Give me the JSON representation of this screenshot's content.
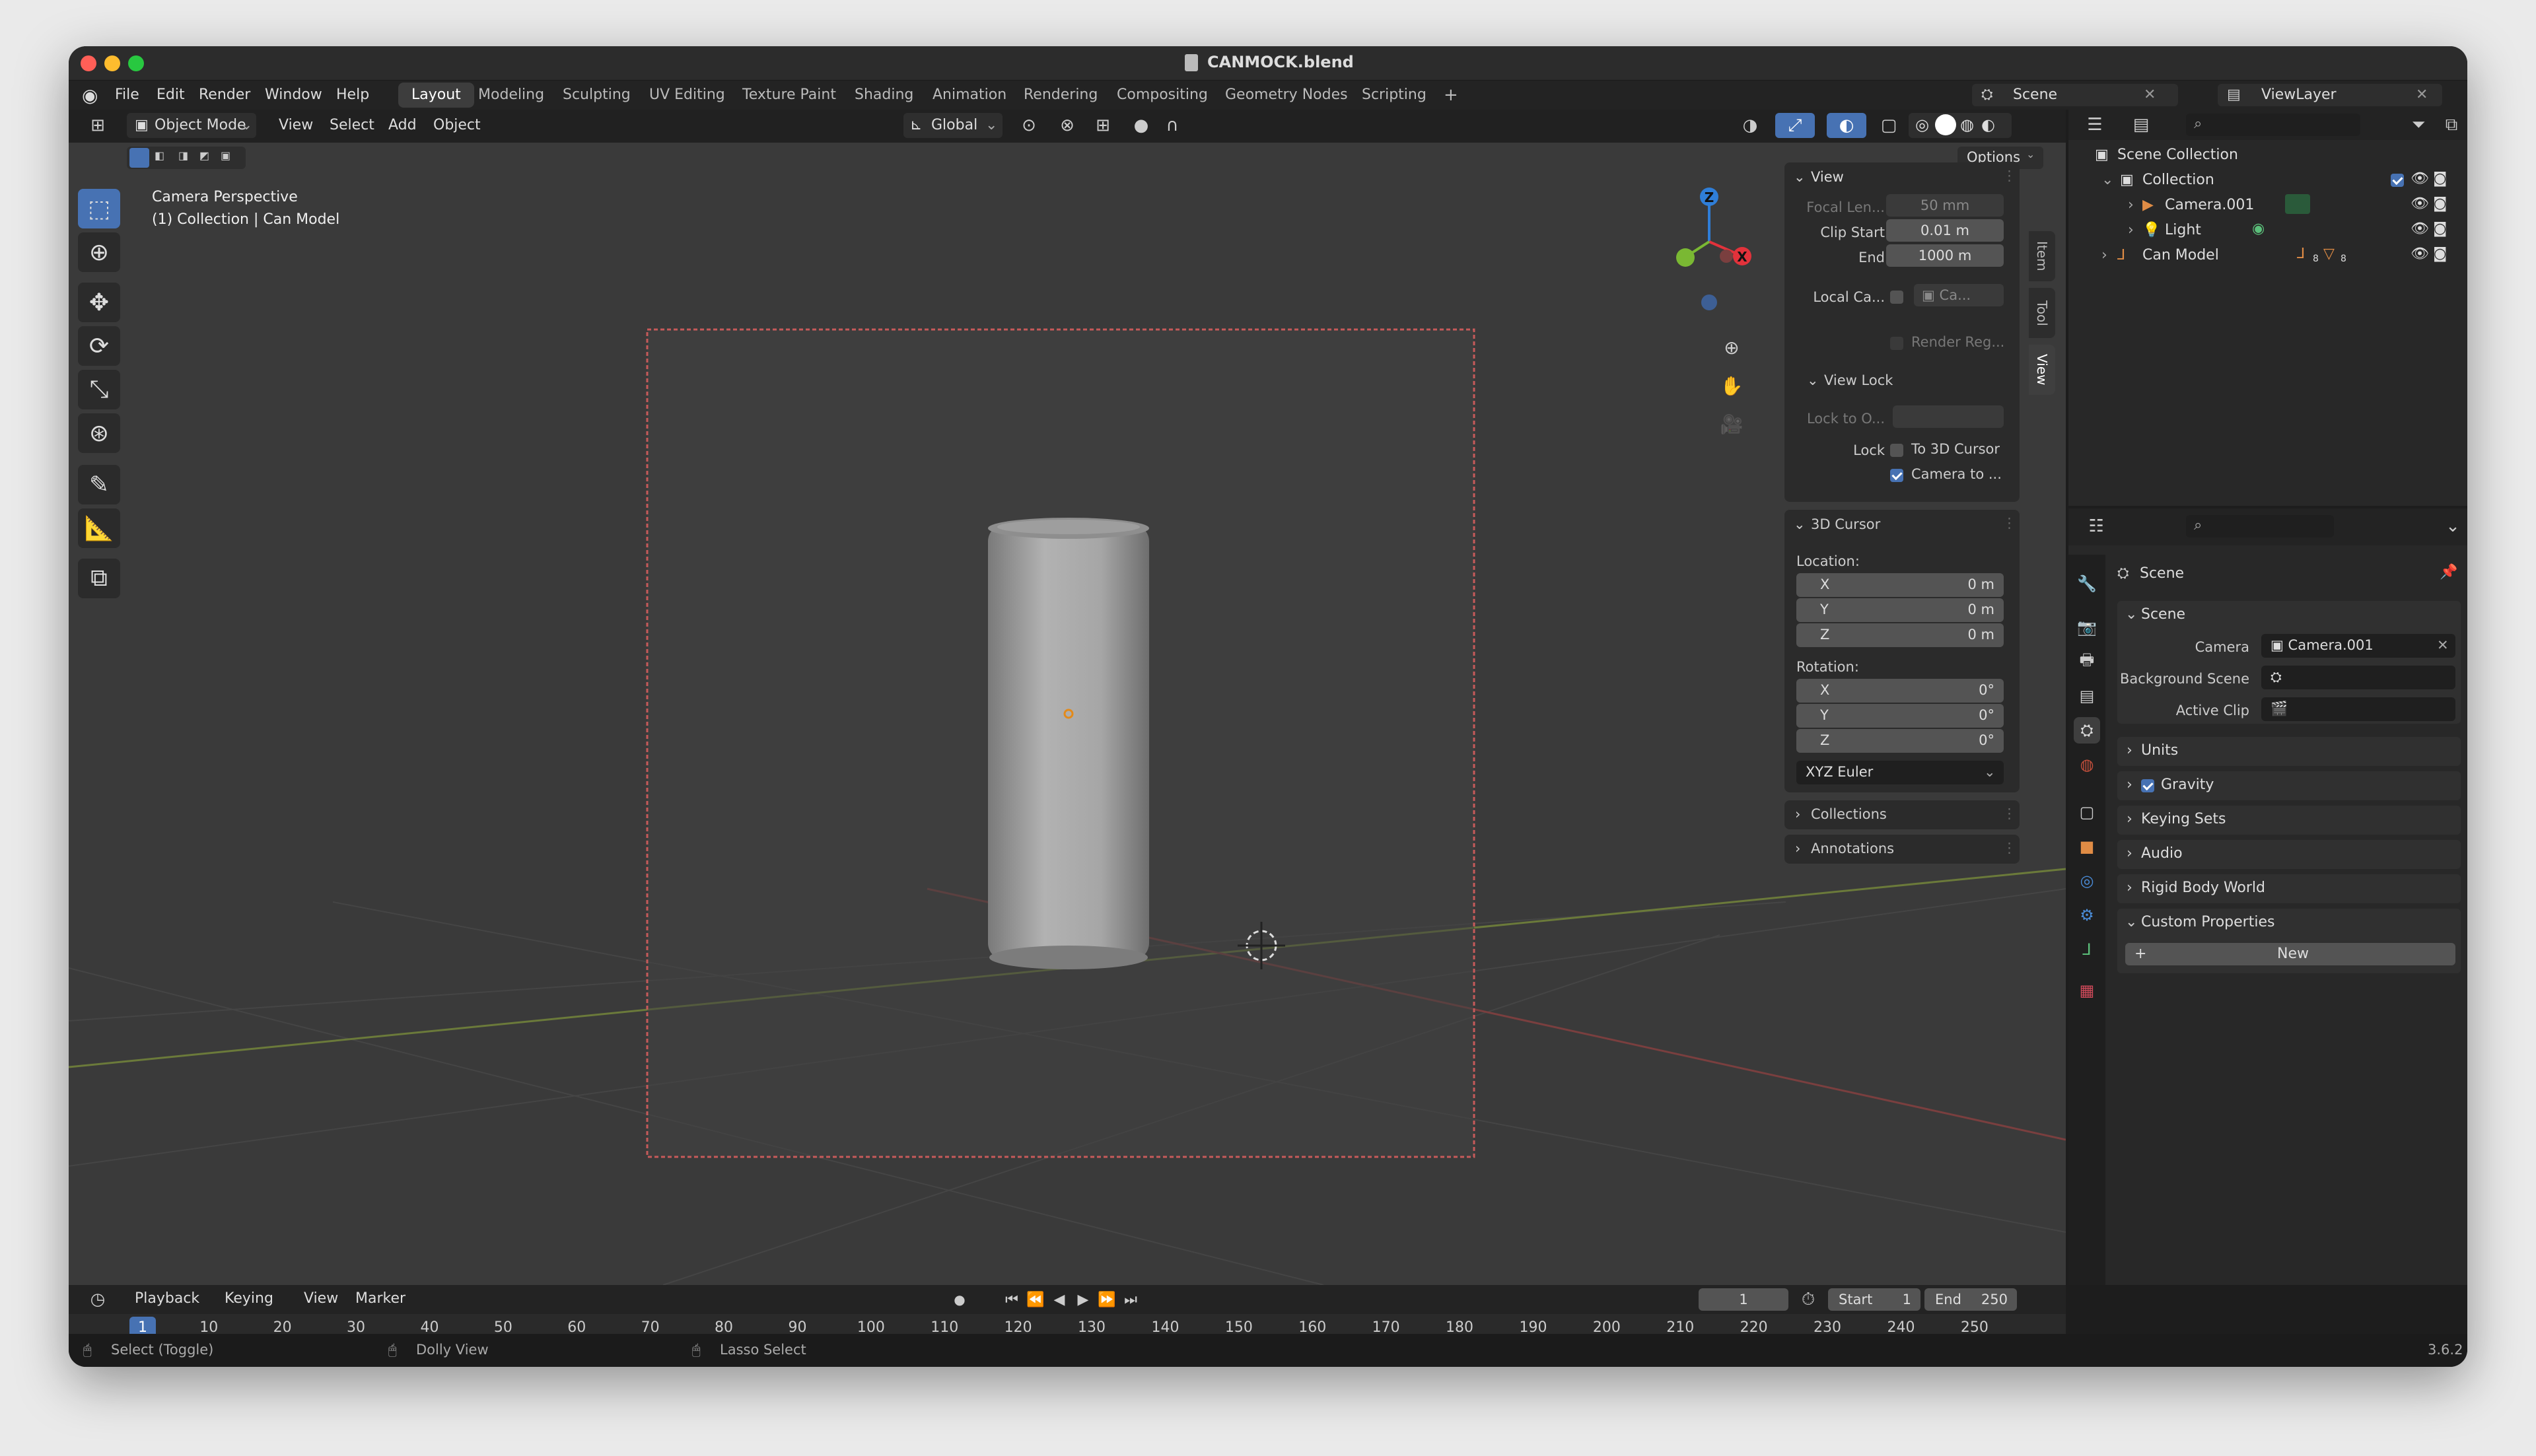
{
  "window": {
    "title": "CANMOCK.blend"
  },
  "menu": [
    "File",
    "Edit",
    "Render",
    "Window",
    "Help"
  ],
  "workspaces": [
    "Layout",
    "Modeling",
    "Sculpting",
    "UV Editing",
    "Texture Paint",
    "Shading",
    "Animation",
    "Rendering",
    "Compositing",
    "Geometry Nodes",
    "Scripting"
  ],
  "workspace_add": "+",
  "scene_selector": {
    "value": "Scene"
  },
  "viewlayer_selector": {
    "value": "ViewLayer"
  },
  "viewport": {
    "mode": "Object Mode",
    "menus": [
      "View",
      "Select",
      "Add",
      "Object"
    ],
    "transform_orientation": "Global",
    "options_label": "Options",
    "overlay_title": "Camera Perspective",
    "overlay_subtitle": "(1) Collection | Can Model",
    "gizmo_axes": {
      "x": "X",
      "y": "Y",
      "z": "Z"
    }
  },
  "npanel": {
    "tabs": [
      "Item",
      "Tool",
      "View"
    ],
    "view": {
      "title": "View",
      "focal_length_label": "Focal Len...",
      "focal_length_value": "50 mm",
      "clip_start_label": "Clip Start",
      "clip_start_value": "0.01 m",
      "clip_end_label": "End",
      "clip_end_value": "1000 m",
      "local_camera_label": "Local Ca...",
      "local_camera_value": "Ca...",
      "render_region_label": "Render Reg..."
    },
    "view_lock": {
      "title": "View Lock",
      "lock_to_object_label": "Lock to O...",
      "lock_label": "Lock",
      "to_3d_cursor_label": "To 3D Cursor",
      "camera_to_view_label": "Camera to ...",
      "camera_to_view_checked": true
    },
    "cursor": {
      "title": "3D Cursor",
      "location_label": "Location:",
      "loc_x_label": "X",
      "loc_x": "0 m",
      "loc_y_label": "Y",
      "loc_y": "0 m",
      "loc_z_label": "Z",
      "loc_z": "0 m",
      "rotation_label": "Rotation:",
      "rot_x_label": "X",
      "rot_x": "0°",
      "rot_y_label": "Y",
      "rot_y": "0°",
      "rot_z_label": "Z",
      "rot_z": "0°",
      "rotation_mode": "XYZ Euler"
    },
    "collections_title": "Collections",
    "annotations_title": "Annotations"
  },
  "outliner": {
    "root": "Scene Collection",
    "collection": "Collection",
    "items": [
      {
        "name": "Camera.001"
      },
      {
        "name": "Light"
      },
      {
        "name": "Can Model",
        "badge_a": "8",
        "badge_b": "8"
      }
    ]
  },
  "properties": {
    "header": "Scene",
    "scene_section": "Scene",
    "camera_label": "Camera",
    "camera_value": "Camera.001",
    "background_scene_label": "Background Scene",
    "active_clip_label": "Active Clip",
    "units_label": "Units",
    "gravity_label": "Gravity",
    "gravity_checked": true,
    "keying_sets_label": "Keying Sets",
    "audio_label": "Audio",
    "rigid_body_world_label": "Rigid Body World",
    "custom_properties_label": "Custom Properties",
    "new_button_label": "New",
    "new_button_prefix": "+"
  },
  "timeline": {
    "menus": [
      "Playback",
      "Keying",
      "View",
      "Marker"
    ],
    "current_frame": "1",
    "start_label": "Start",
    "start_value": "1",
    "end_label": "End",
    "end_value": "250",
    "frame_indicator": "1",
    "ticks": [
      "10",
      "20",
      "30",
      "40",
      "50",
      "60",
      "70",
      "80",
      "90",
      "100",
      "110",
      "120",
      "130",
      "140",
      "150",
      "160",
      "170",
      "180",
      "190",
      "200",
      "210",
      "220",
      "230",
      "240",
      "250"
    ]
  },
  "statusbar": {
    "select_toggle": "Select (Toggle)",
    "dolly_view": "Dolly View",
    "lasso_select": "Lasso Select",
    "version": "3.6.2"
  },
  "colors": {
    "accent": "#4772b3",
    "axis_x": "#e2323b",
    "axis_y": "#7ab833",
    "axis_z": "#2f7ed8",
    "camera_frame": "#c65a5a"
  }
}
